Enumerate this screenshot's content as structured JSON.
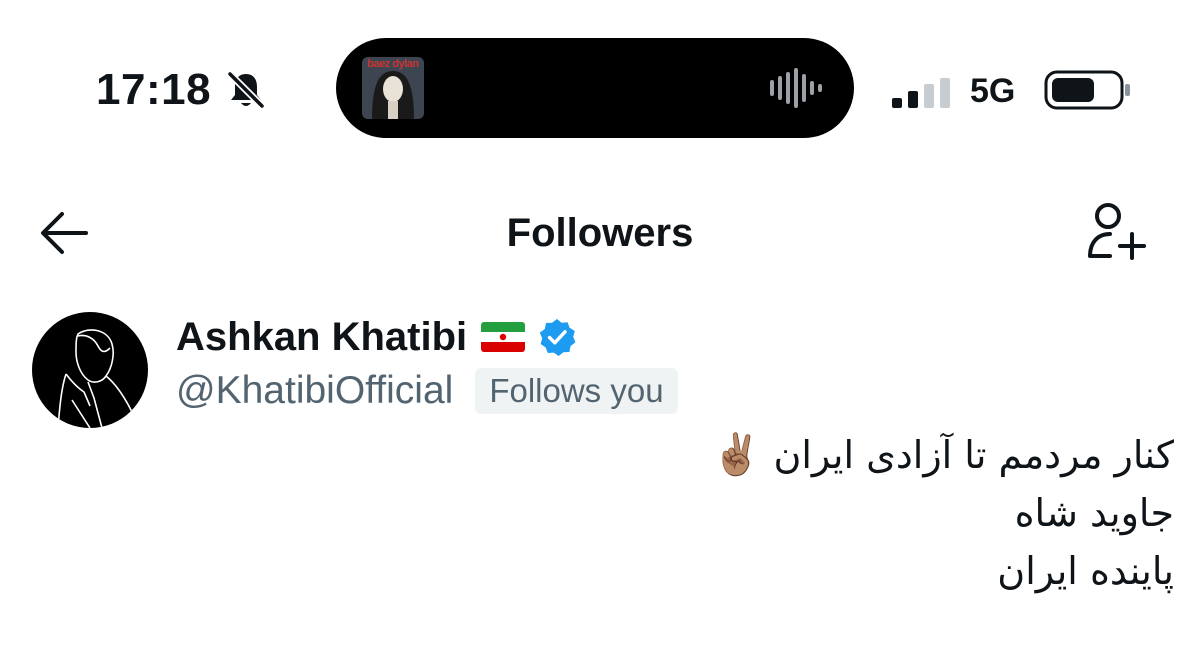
{
  "status_bar": {
    "time": "17:18",
    "network": "5G",
    "icons": [
      "bell-slash-icon",
      "waveform-icon",
      "signal-icon",
      "battery-icon"
    ],
    "now_playing": {
      "album_text": "baez dylan"
    }
  },
  "header": {
    "title": "Followers",
    "back_icon": "arrow-left-icon",
    "add_icon": "person-add-icon"
  },
  "followers": [
    {
      "name": "Ashkan Khatibi",
      "flag_emoji": "🇮🇷",
      "verified": true,
      "handle": "@KhatibiOfficial",
      "follows_you_label": "Follows you",
      "bio": {
        "line1": "کنار مردمم تا آزادی ایران",
        "line1_emoji": "✌🏽",
        "line2": "جاوید شاه",
        "line3": "پاینده ایران"
      }
    }
  ],
  "colors": {
    "text_primary": "#0f1419",
    "text_secondary": "#536471",
    "badge_bg": "#eff3f4",
    "verified_blue": "#1d9bf0",
    "flag_green": "#239f40",
    "flag_red": "#da0000"
  }
}
